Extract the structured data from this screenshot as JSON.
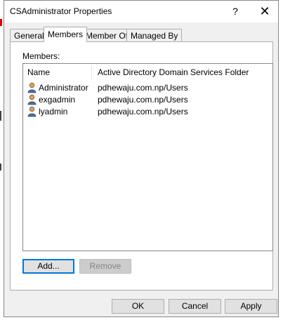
{
  "window": {
    "title": "CSAdministrator Properties",
    "help_label": "?",
    "close_label": "✕"
  },
  "tabs": [
    {
      "label": "General",
      "active": false
    },
    {
      "label": "Members",
      "active": true
    },
    {
      "label": "Member Of",
      "active": false
    },
    {
      "label": "Managed By",
      "active": false
    }
  ],
  "members": {
    "label": "Members:",
    "columns": [
      "Name",
      "Active Directory Domain Services Folder"
    ],
    "rows": [
      {
        "name": "Administrator",
        "folder": "pdhewaju.com.np/Users",
        "icon": "user-icon"
      },
      {
        "name": "exgadmin",
        "folder": "pdhewaju.com.np/Users",
        "icon": "user-icon"
      },
      {
        "name": "lyadmin",
        "folder": "pdhewaju.com.np/Users",
        "icon": "user-icon"
      }
    ],
    "add_label": "Add...",
    "remove_label": "Remove"
  },
  "footer": {
    "ok_label": "OK",
    "cancel_label": "Cancel",
    "apply_label": "Apply"
  }
}
